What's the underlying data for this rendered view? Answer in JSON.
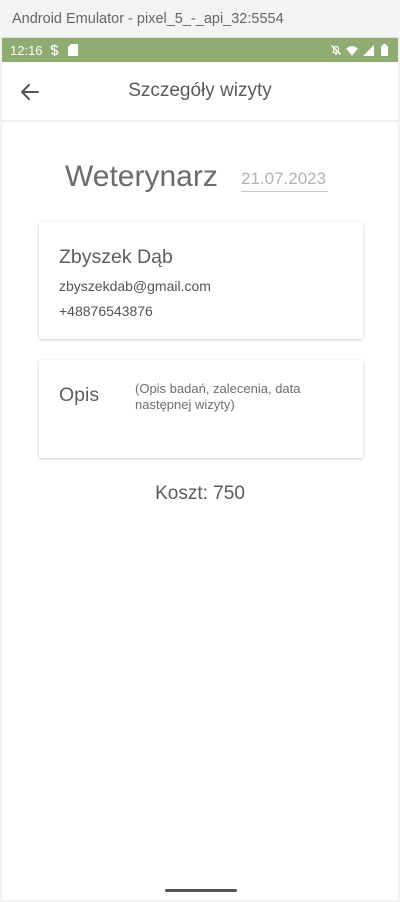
{
  "emulator": {
    "title": "Android Emulator - pixel_5_-_api_32:5554"
  },
  "status_bar": {
    "time": "12:16",
    "background": "#8fac72"
  },
  "app_bar": {
    "title": "Szczegóły wizyty"
  },
  "visit": {
    "specialty": "Weterynarz",
    "date": "21.07.2023",
    "vet": {
      "name": "Zbyszek Dąb",
      "email": "zbyszekdab@gmail.com",
      "phone": "+48876543876"
    },
    "description": {
      "label": "Opis",
      "placeholder": "(Opis badań, zalecenia, data następnej wizyty)"
    },
    "cost_text": "Koszt: 750"
  }
}
